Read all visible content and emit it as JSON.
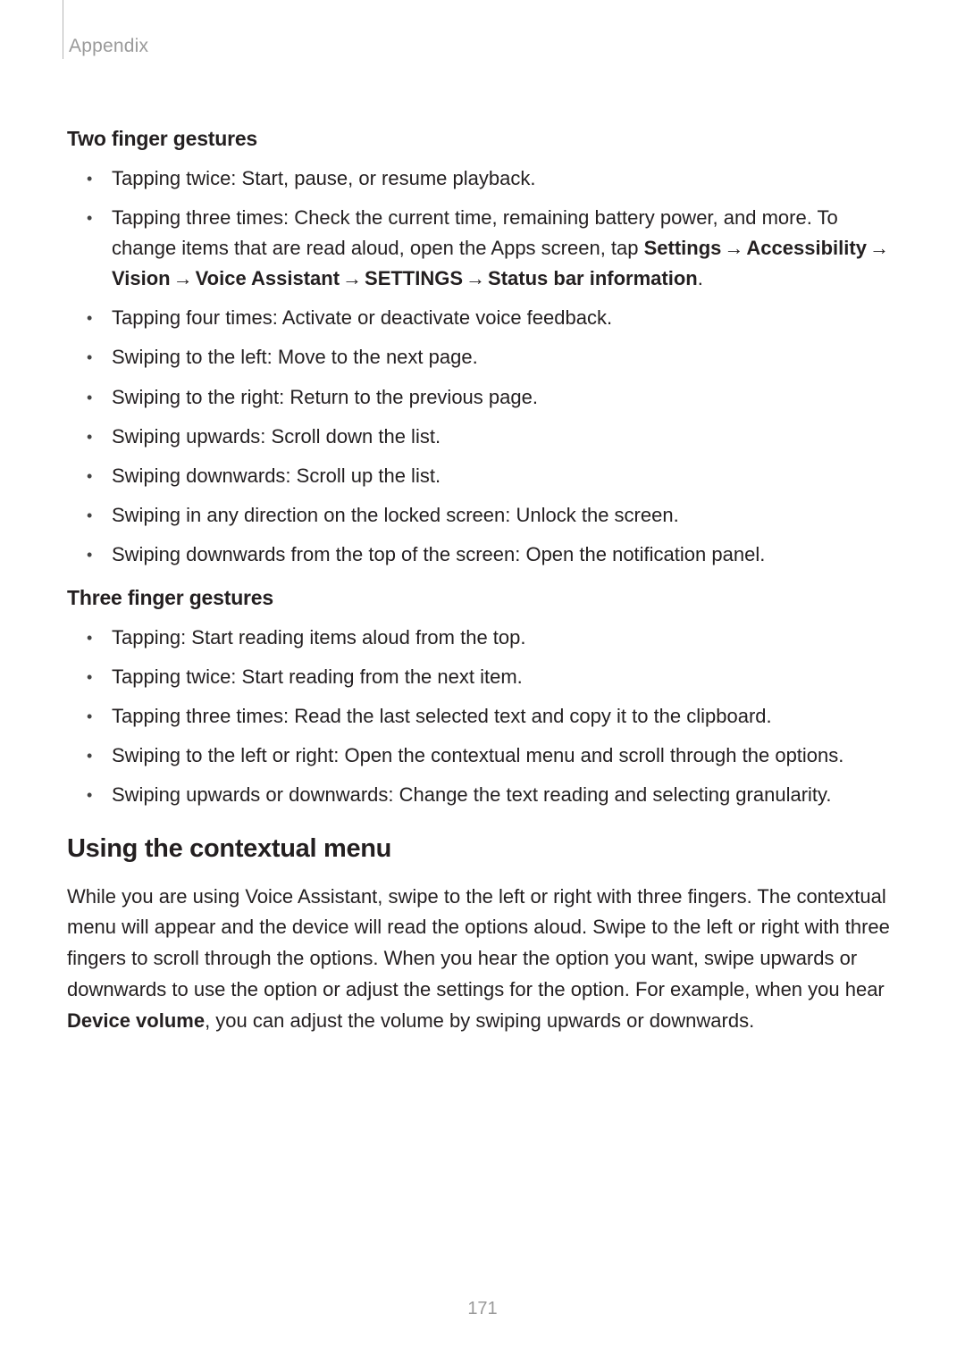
{
  "header": {
    "section": "Appendix"
  },
  "two_finger": {
    "title": "Two finger gestures",
    "items": [
      {
        "text": "Tapping twice: Start, pause, or resume playback."
      },
      {
        "pre": "Tapping three times: Check the current time, remaining battery power, and more. To change items that are read aloud, open the Apps screen, tap ",
        "path": [
          "Settings",
          "Accessibility",
          "Vision",
          "Voice Assistant",
          "SETTINGS",
          "Status bar information"
        ],
        "post": "."
      },
      {
        "text": "Tapping four times: Activate or deactivate voice feedback."
      },
      {
        "text": "Swiping to the left: Move to the next page."
      },
      {
        "text": "Swiping to the right: Return to the previous page."
      },
      {
        "text": "Swiping upwards: Scroll down the list."
      },
      {
        "text": "Swiping downwards: Scroll up the list."
      },
      {
        "text": "Swiping in any direction on the locked screen: Unlock the screen."
      },
      {
        "text": "Swiping downwards from the top of the screen: Open the notification panel."
      }
    ]
  },
  "three_finger": {
    "title": "Three finger gestures",
    "items": [
      {
        "text": "Tapping: Start reading items aloud from the top."
      },
      {
        "text": "Tapping twice: Start reading from the next item."
      },
      {
        "text": "Tapping three times: Read the last selected text and copy it to the clipboard."
      },
      {
        "text": "Swiping to the left or right: Open the contextual menu and scroll through the options."
      },
      {
        "text": "Swiping upwards or downwards: Change the text reading and selecting granularity."
      }
    ]
  },
  "contextual": {
    "title": "Using the contextual menu",
    "body_pre": "While you are using Voice Assistant, swipe to the left or right with three fingers. The contextual menu will appear and the device will read the options aloud. Swipe to the left or right with three fingers to scroll through the options. When you hear the option you want, swipe upwards or downwards to use the option or adjust the settings for the option. For example, when you hear ",
    "body_bold": "Device volume",
    "body_post": ", you can adjust the volume by swiping upwards or downwards."
  },
  "arrow_glyph": "→",
  "page_number": "171"
}
